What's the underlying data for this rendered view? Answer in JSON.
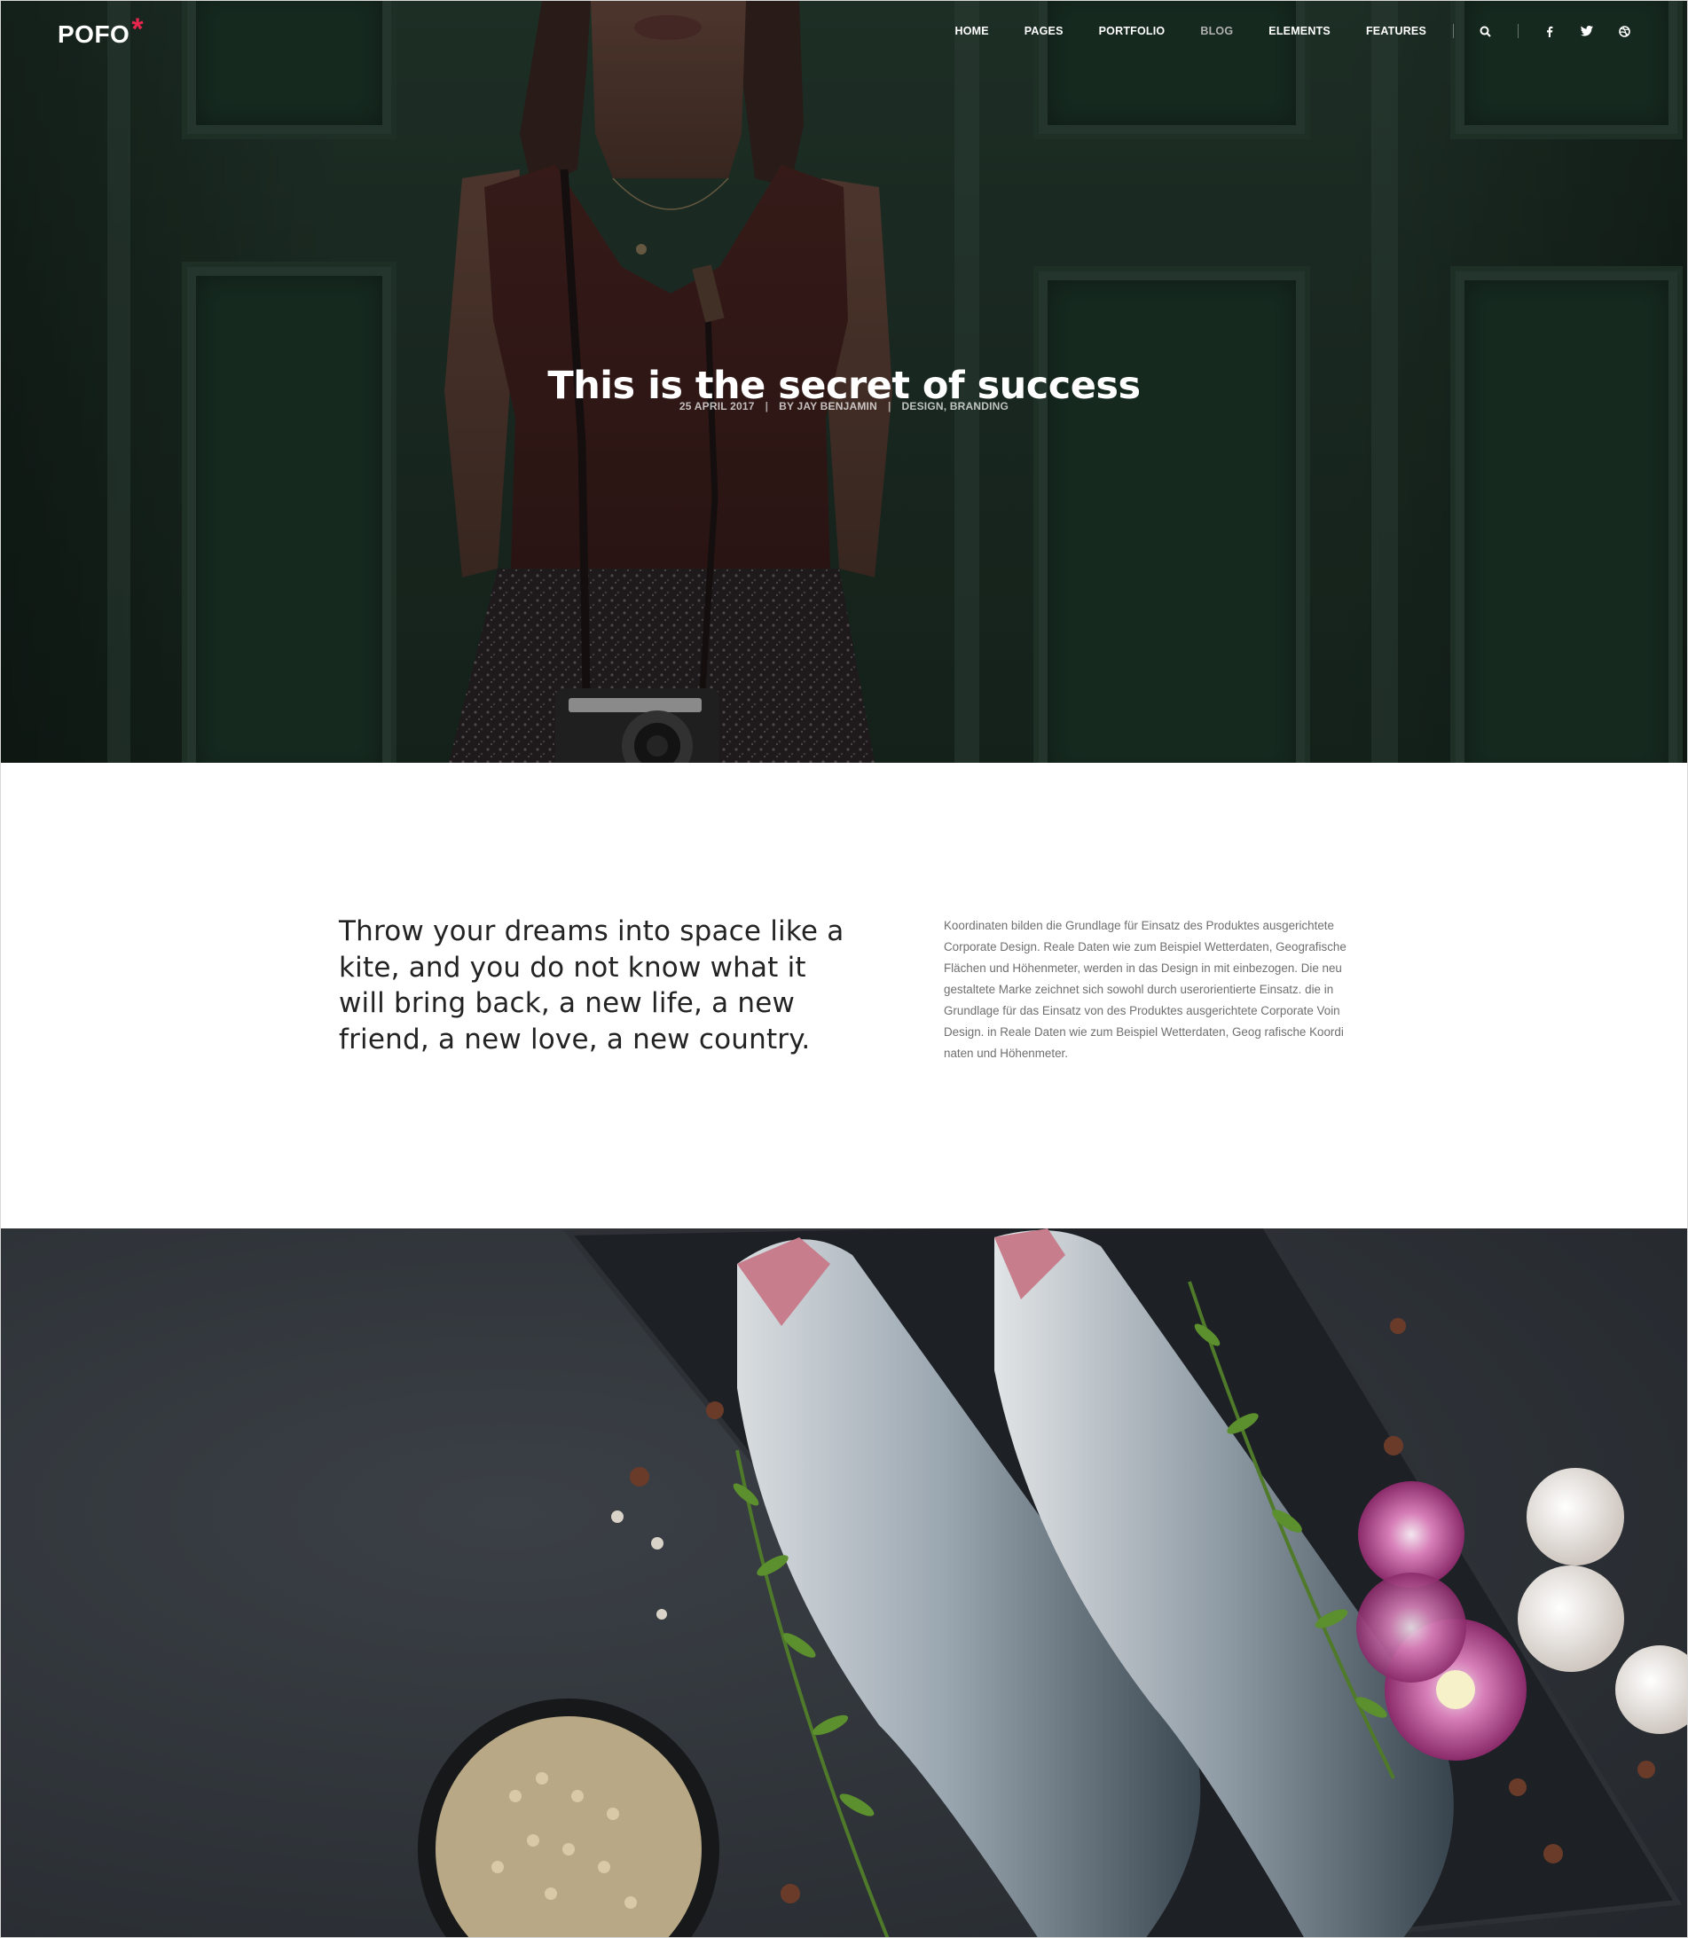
{
  "header": {
    "logo_text": "POFO",
    "logo_mark": "*",
    "nav": [
      {
        "label": "HOME",
        "active": false
      },
      {
        "label": "PAGES",
        "active": false
      },
      {
        "label": "PORTFOLIO",
        "active": false
      },
      {
        "label": "BLOG",
        "active": true
      },
      {
        "label": "ELEMENTS",
        "active": false
      },
      {
        "label": "FEATURES",
        "active": false
      }
    ],
    "icons": [
      "search-icon",
      "facebook-icon",
      "twitter-icon",
      "dribbble-icon"
    ]
  },
  "hero": {
    "title": "This is the secret of success",
    "date": "25 APRIL 2017",
    "author": "BY JAY BENJAMIN",
    "categories": "DESIGN, BRANDING"
  },
  "intro": {
    "quote": "Throw your dreams into space like a kite, and you do not know what it will bring back, a new life, a new friend, a new love, a new country.",
    "body": "Koordinaten bilden die Grundlage für Einsatz des Produktes ausgerichtete Corporate Design. Reale Daten wie zum Beispiel Wetterdaten, Geografische Flächen und Höhenmeter, werden in das Design in mit einbezogen. Die neu gestaltete Marke zeichnet sich sowohl durch userorientierte Einsatz. die in Grundlage für das Einsatz von des Produktes ausgerichtete Corporate Voin Design. in Reale Daten wie zum Beispiel Wetterdaten, Geog rafische Koordi naten und Höhenmeter."
  },
  "colors": {
    "accent": "#e6264d",
    "nav_active": "#b0b0b0",
    "quote_text": "#232323",
    "body_text": "#6f6f6f"
  }
}
